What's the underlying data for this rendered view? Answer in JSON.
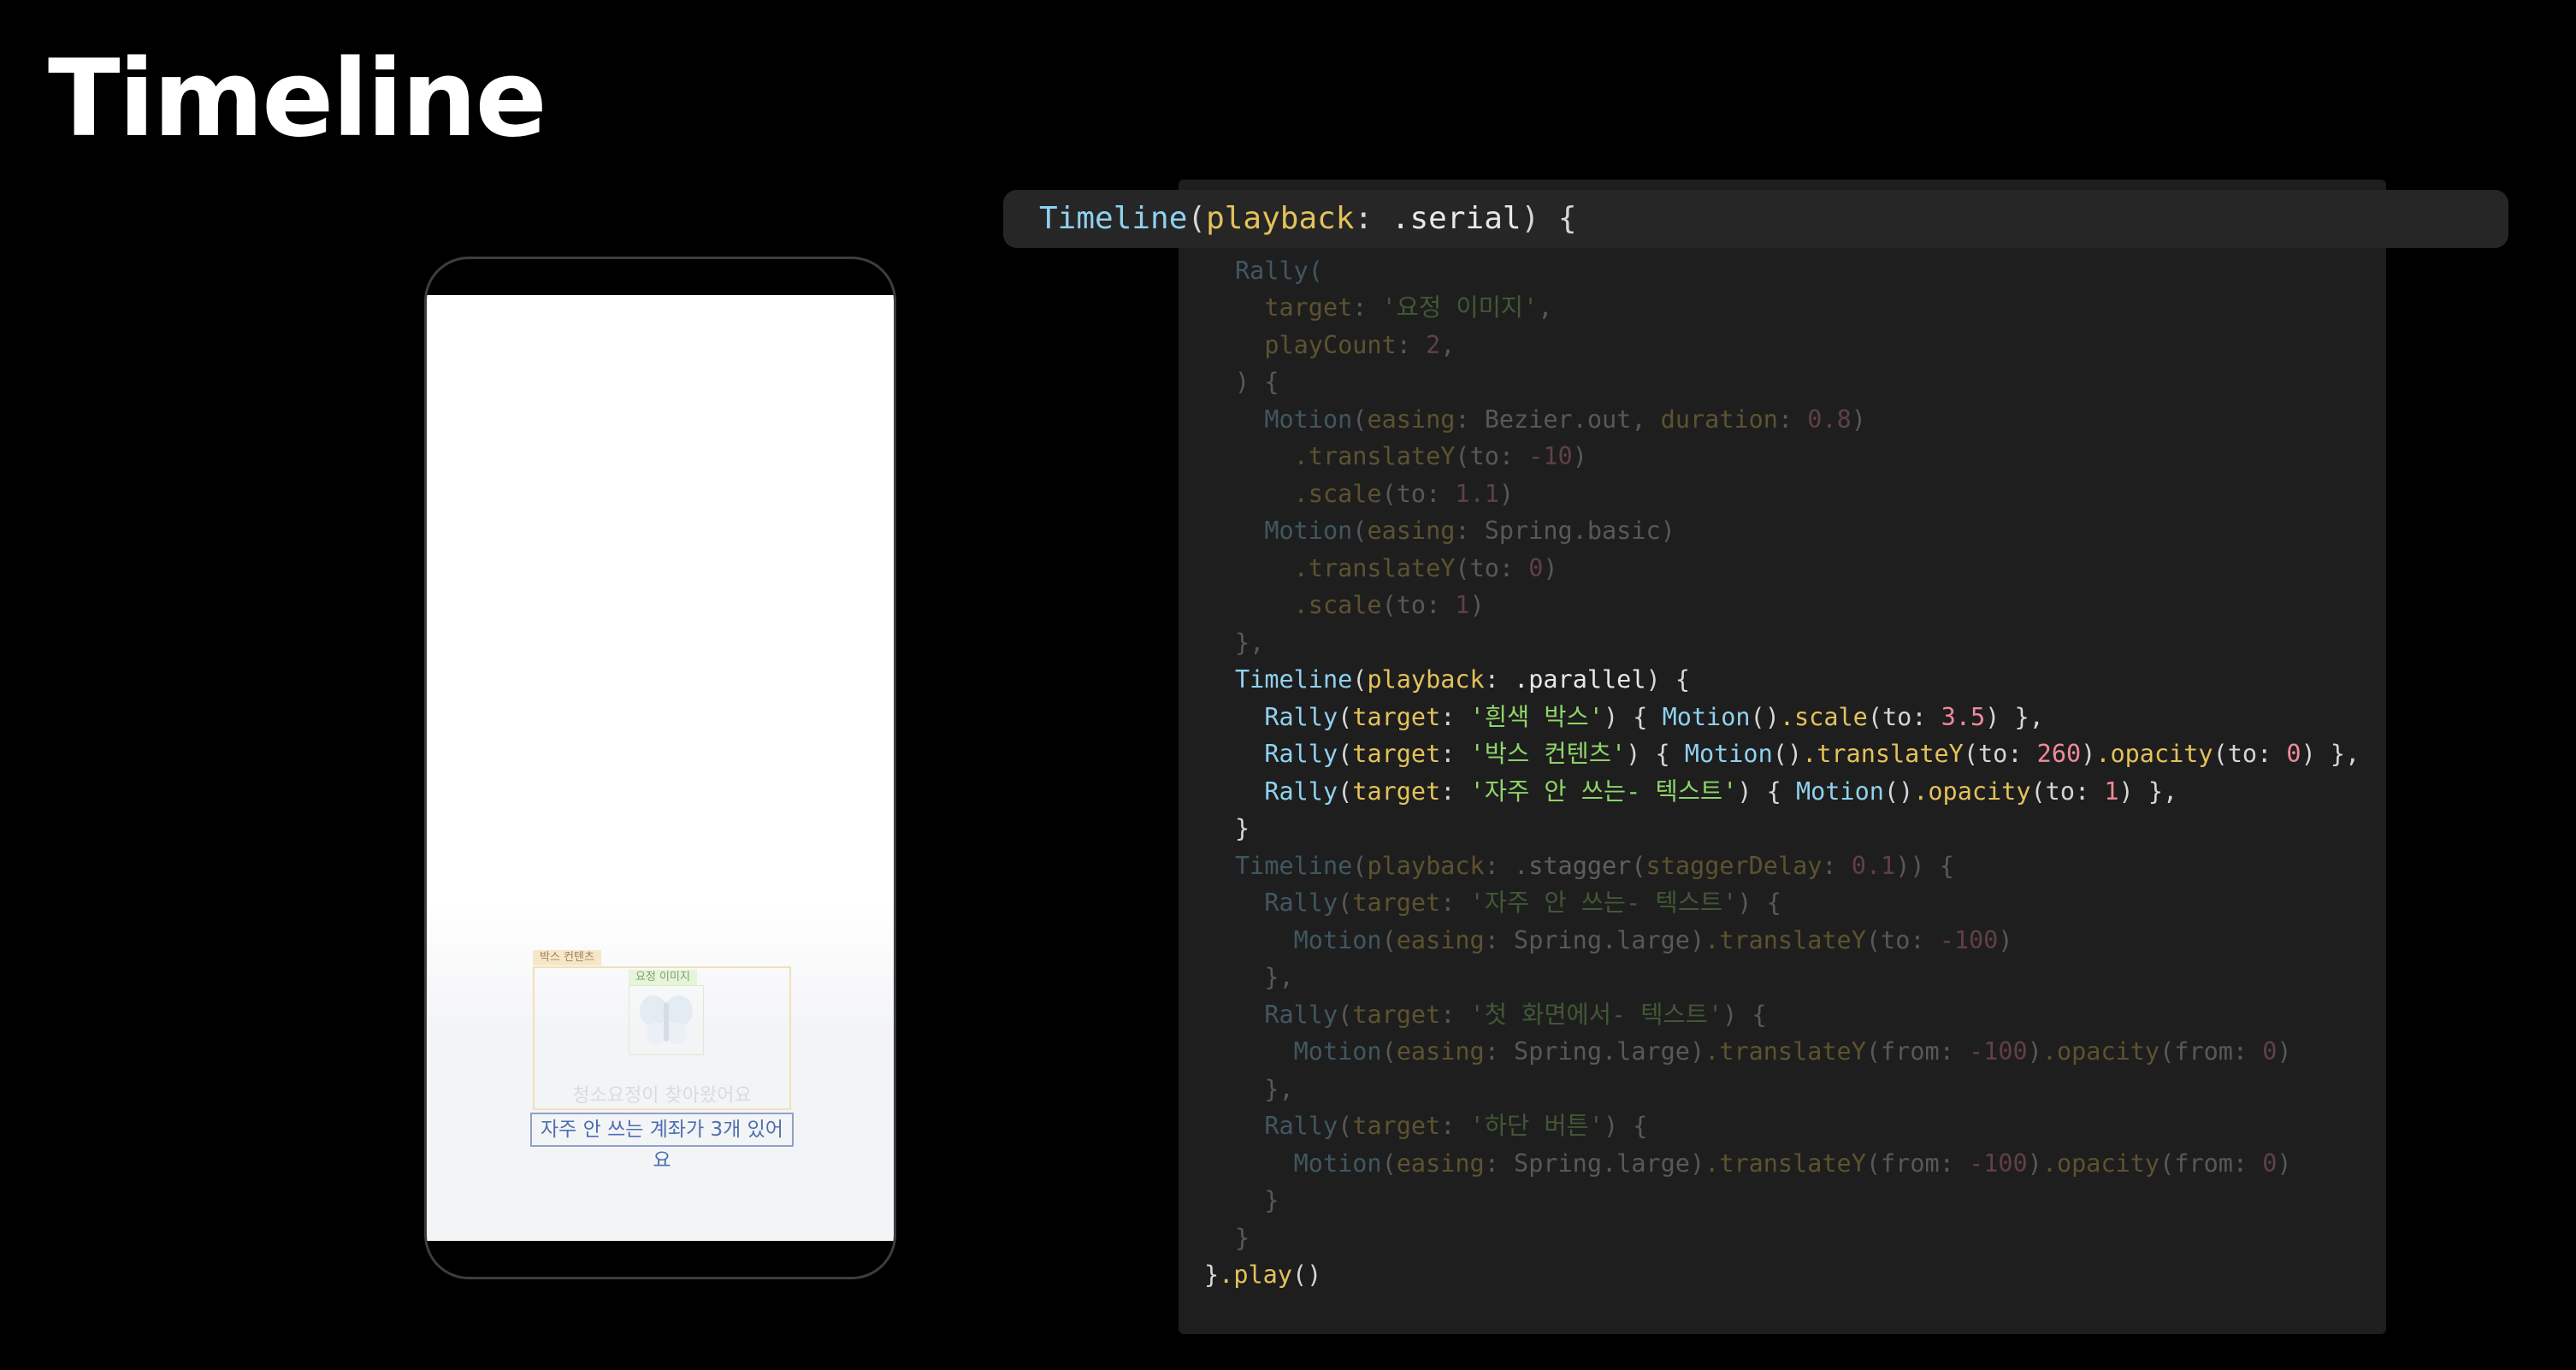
{
  "slide": {
    "title": "Timeline"
  },
  "phone": {
    "chip_box_content": "박스 컨텐츠",
    "chip_image": "요정 이미지",
    "faint_text": "청소요정이 찾아왔어요",
    "highlight_text": "자주 안 쓰는 계좌가 3개 있어요"
  },
  "code": {
    "header": {
      "fn": "Timeline",
      "param": "playback",
      "value": ".serial",
      "close": ") {"
    },
    "rally1": {
      "open": "Rally(",
      "target_key": "target",
      "target_val": "'요정 이미지'",
      "count_key": "playCount",
      "count_val": "2",
      "close": ") {",
      "m1_fn": "Motion",
      "m1_easing_key": "easing",
      "m1_easing_val": "Bezier.out",
      "m1_duration_key": "duration",
      "m1_duration_val": "0.8",
      "m1_ty_method": ".translateY",
      "m1_ty_key": "to",
      "m1_ty_val": "-10",
      "m1_sc_method": ".scale",
      "m1_sc_key": "to",
      "m1_sc_val": "1.1",
      "m2_fn": "Motion",
      "m2_easing_key": "easing",
      "m2_easing_val": "Spring.basic",
      "m2_ty_method": ".translateY",
      "m2_ty_key": "to",
      "m2_ty_val": "0",
      "m2_sc_method": ".scale",
      "m2_sc_key": "to",
      "m2_sc_val": "1",
      "end": "},"
    },
    "parallel": {
      "fn": "Timeline",
      "param": "playback",
      "value": ".parallel",
      "close": ") {",
      "rows": [
        {
          "rally": "Rally",
          "key": "target",
          "name": "'흰색 박스'",
          "motion": "Motion",
          "method": ".scale",
          "arg": "to",
          "val": "3.5"
        },
        {
          "rally": "Rally",
          "key": "target",
          "name": "'박스 컨텐츠'",
          "motion": "Motion",
          "method": ".translateY",
          "arg": "to",
          "val": "260",
          "method2": ".opacity",
          "arg2": "to",
          "val2": "0"
        },
        {
          "rally": "Rally",
          "key": "target",
          "name": "'자주 안 쓰는- 텍스트'",
          "motion": "Motion",
          "method": ".opacity",
          "arg": "to",
          "val": "1"
        }
      ],
      "end": "}"
    },
    "stagger": {
      "fn": "Timeline",
      "param": "playback",
      "value": ".stagger(",
      "delay_key": "staggerDelay",
      "delay_val": "0.1",
      "close": ")) {",
      "groups": [
        {
          "rally": "Rally",
          "key": "target",
          "name": "'자주 안 쓰는- 텍스트'",
          "motion": "Motion",
          "easing_key": "easing",
          "easing_val": "Spring.large",
          "method": ".translateY",
          "arg": "to",
          "val": "-100"
        },
        {
          "rally": "Rally",
          "key": "target",
          "name": "'첫 화면에서- 텍스트'",
          "motion": "Motion",
          "easing_key": "easing",
          "easing_val": "Spring.large",
          "method": ".translateY",
          "arg": "from",
          "val": "-100",
          "method2": ".opacity",
          "arg2": "from",
          "val2": "0"
        },
        {
          "rally": "Rally",
          "key": "target",
          "name": "'하단 버튼'",
          "motion": "Motion",
          "easing_key": "easing",
          "easing_val": "Spring.large",
          "method": ".translateY",
          "arg": "from",
          "val": "-100",
          "method2": ".opacity",
          "arg2": "from",
          "val2": "0"
        }
      ],
      "end": "}"
    },
    "footer": {
      "close": "}",
      "play": ".play",
      "parens": "()"
    }
  }
}
